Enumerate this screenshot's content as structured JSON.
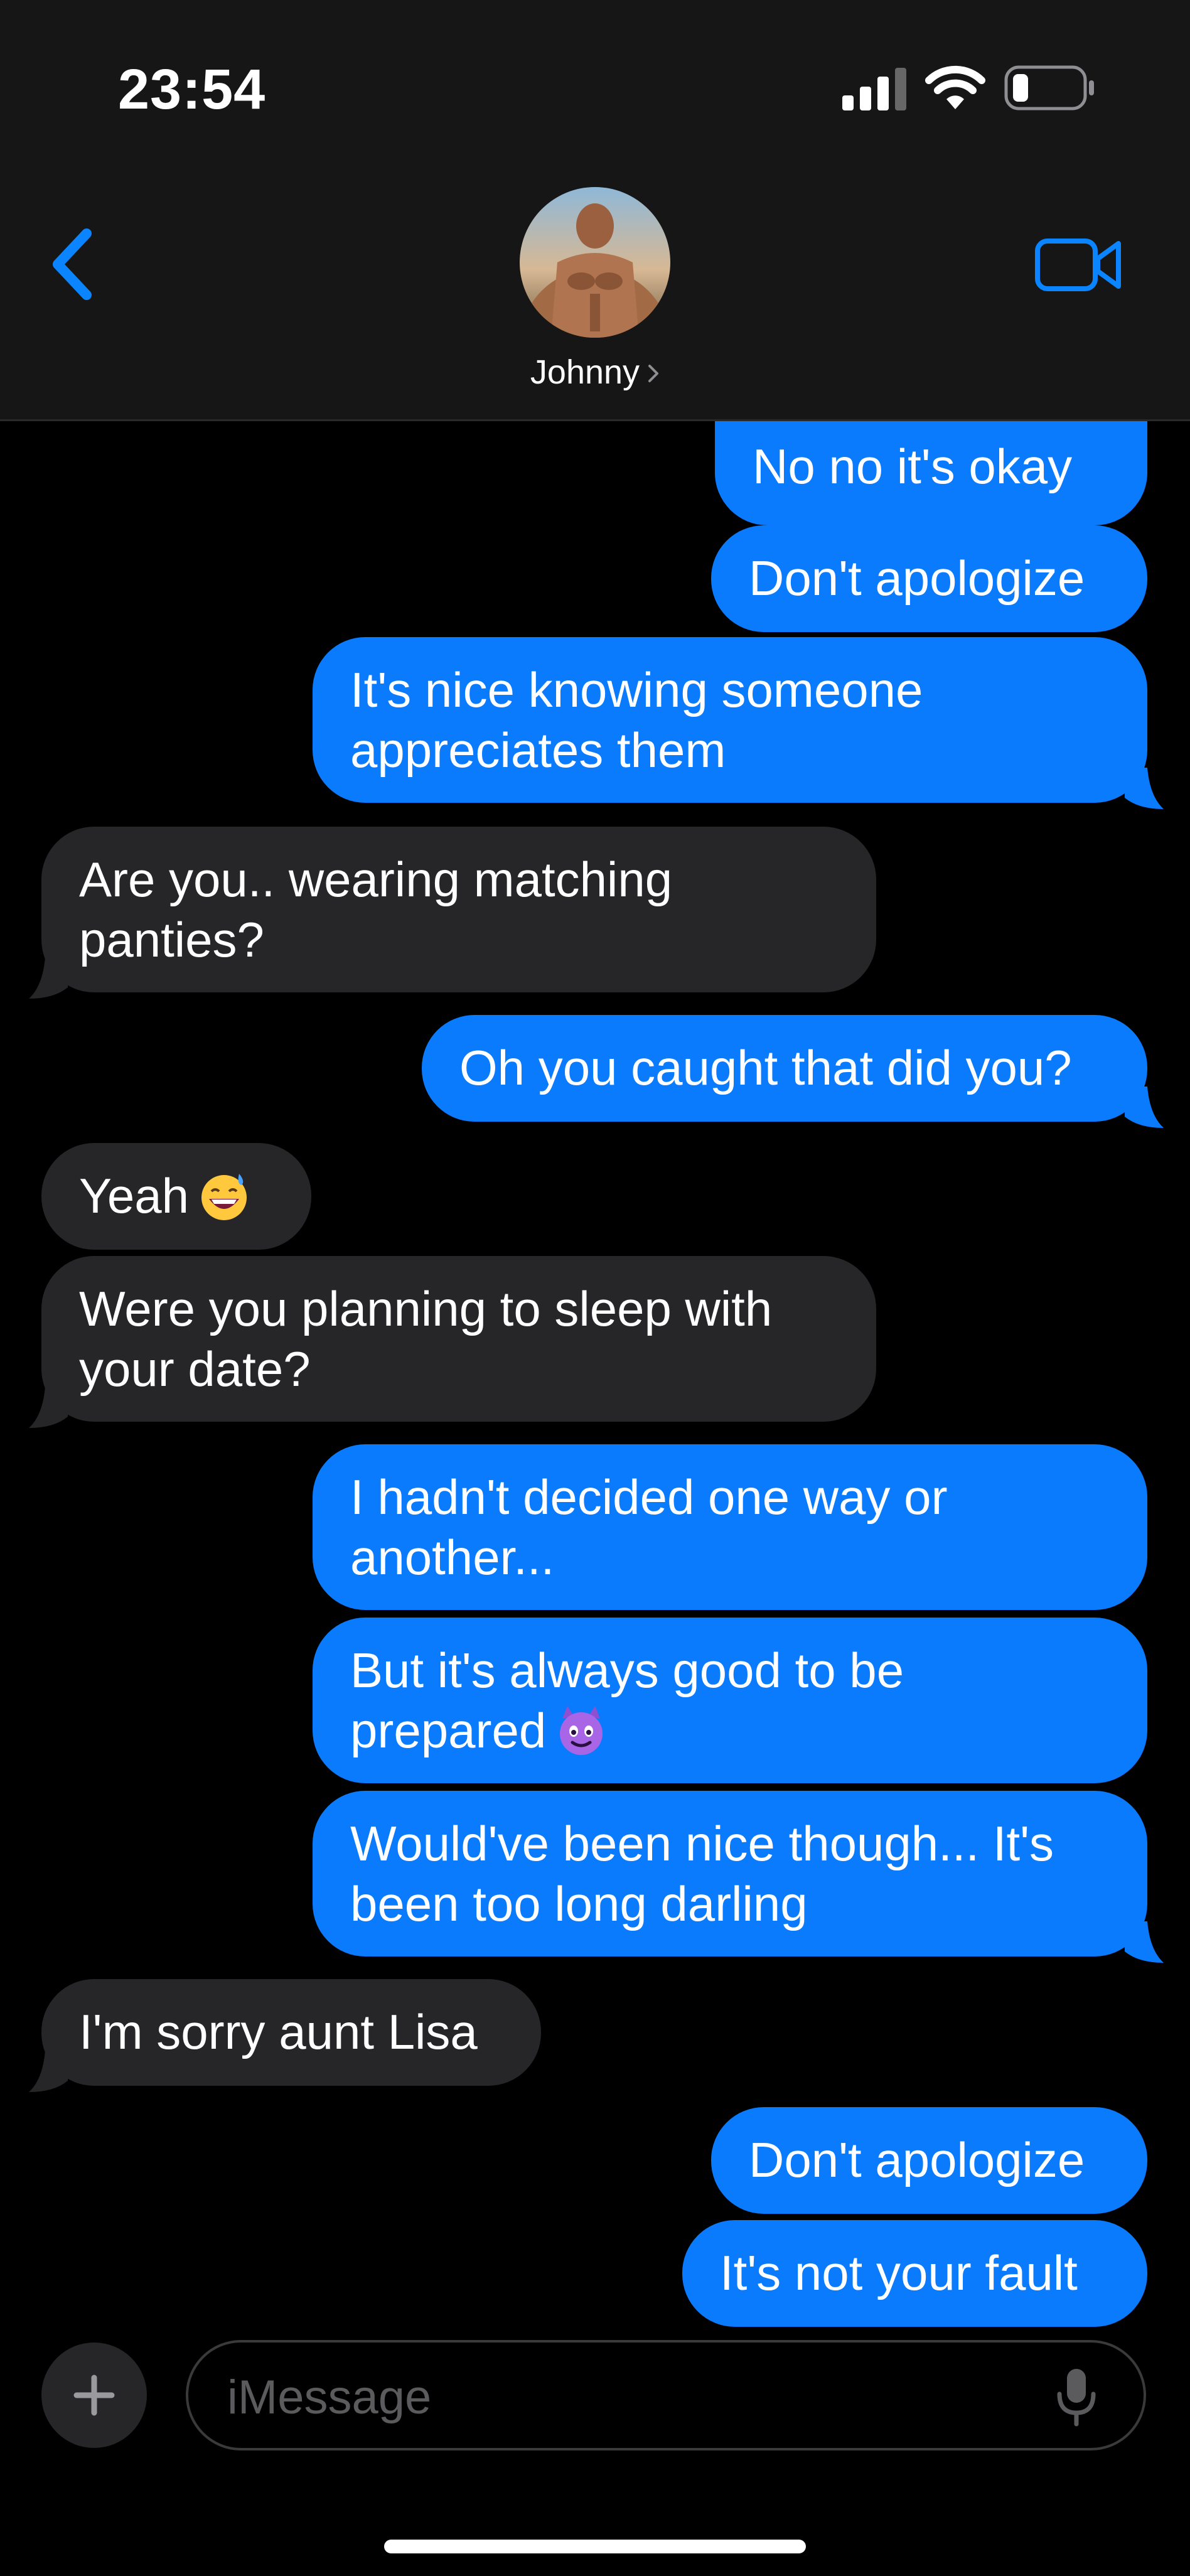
{
  "status_bar": {
    "time": "23:54",
    "signal_icon": "cellular-signal-icon",
    "wifi_icon": "wifi-icon",
    "battery_icon": "battery-low-icon"
  },
  "header": {
    "back_icon": "chevron-left-icon",
    "contact_name": "Johnny",
    "name_chevron_icon": "chevron-right-icon",
    "video_icon": "video-camera-icon"
  },
  "messages": [
    {
      "from": "me",
      "text": "No no it's okay"
    },
    {
      "from": "me",
      "text": "Don't apologize"
    },
    {
      "from": "me",
      "text": "It's nice knowing someone\nappreciates them"
    },
    {
      "from": "them",
      "text": "Are you.. wearing matching\npanties?"
    },
    {
      "from": "me",
      "text": "Oh you caught that did you?"
    },
    {
      "from": "them",
      "text": "Yeah",
      "emoji": "grinning-sweat-emoji"
    },
    {
      "from": "them",
      "text": "Were you planning to sleep with\nyour date?"
    },
    {
      "from": "me",
      "text": "I hadn't decided one way or\nanother..."
    },
    {
      "from": "me",
      "text": "But it's always good to be\nprepared",
      "emoji": "smiling-devil-emoji"
    },
    {
      "from": "me",
      "text": "Would've been nice though... It's\nbeen too long darling"
    },
    {
      "from": "them",
      "text": "I'm sorry aunt Lisa"
    },
    {
      "from": "me",
      "text": "Don't apologize"
    },
    {
      "from": "me",
      "text": "It's not your fault"
    }
  ],
  "compose": {
    "plus_icon": "plus-icon",
    "placeholder": "iMessage",
    "value": "",
    "mic_icon": "microphone-icon"
  },
  "colors": {
    "sent_bubble": "#0b7bfe",
    "received_bubble": "#262628",
    "accent": "#0a84ff",
    "header_bg": "#161616",
    "background": "#000000"
  }
}
